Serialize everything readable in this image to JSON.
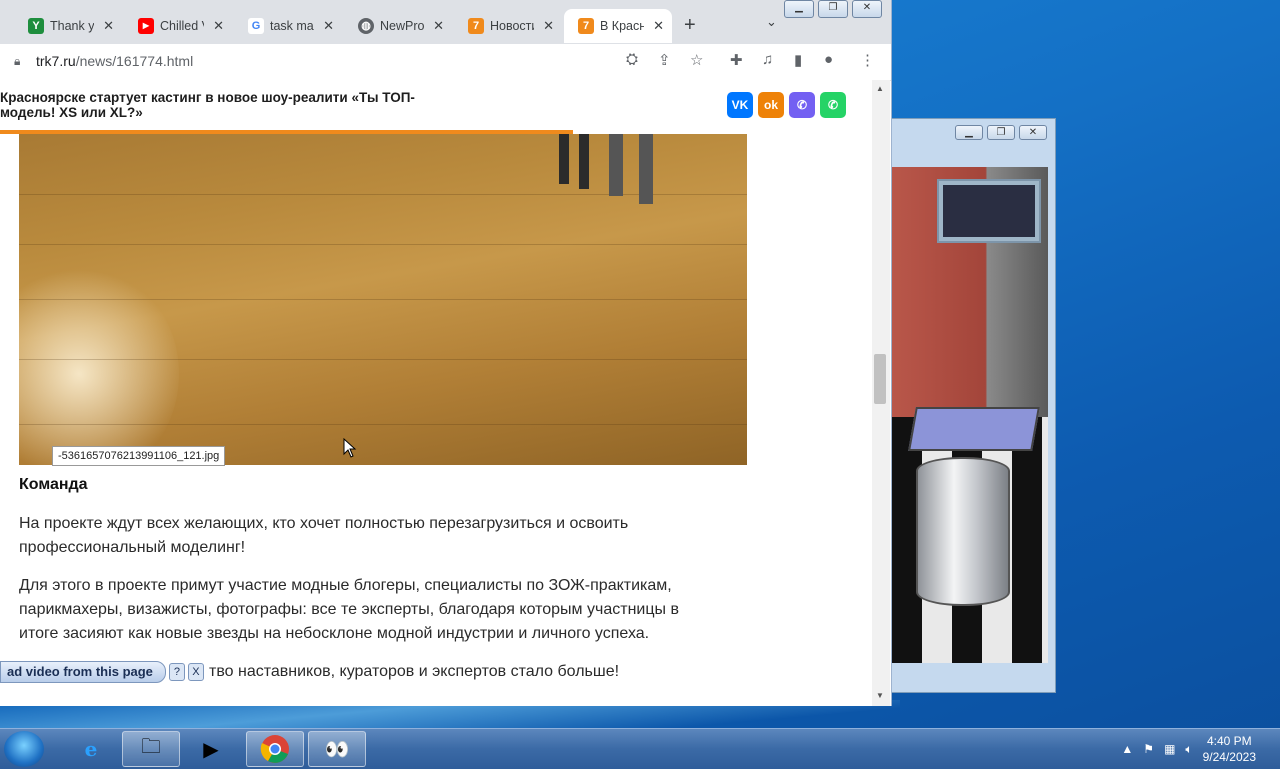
{
  "browser": {
    "tabs": [
      {
        "label": "Thank you",
        "icon": "tab-favicon-green",
        "color": "#1e8e3e",
        "glyph": "Y"
      },
      {
        "label": "Chilled V",
        "icon": "youtube-icon",
        "color": "#ff0000",
        "glyph": "▶"
      },
      {
        "label": "task man",
        "icon": "google-icon",
        "color": "#4285f4",
        "glyph": "G"
      },
      {
        "label": "NewProf",
        "icon": "globe-icon",
        "color": "#5f6368",
        "glyph": "◍"
      },
      {
        "label": "Новости",
        "icon": "trk7-icon",
        "color": "#f08a1c",
        "glyph": "7"
      },
      {
        "label": "В Красн",
        "icon": "trk7-icon",
        "color": "#f08a1c",
        "glyph": "7"
      }
    ],
    "url_domain": "trk7.ru",
    "url_path": "/news/161774.html"
  },
  "article": {
    "sticky_title": "Красноярске стартует кастинг в новое шоу-реалити «Ты ТОП-модель! XS или XL?»",
    "image_filename": "-5361657076213991106_121.jpg",
    "section_heading": "Команда",
    "paragraphs": [
      "На проекте ждут всех желающих, кто хочет полностью перезагрузиться и освоить профессиональный моделинг!",
      "Для этого в проекте примут участие модные блогеры, специалисты по ЗОЖ-практикам, парикмахеры, визажисты, фотографы: все те эксперты, благодаря которым участницы в итоге засияют как новые звезды на небосклоне модной индустрии и личного успеха."
    ],
    "partial_line": "тво наставников, кураторов и экспертов стало больше!"
  },
  "share": [
    {
      "name": "vk-share",
      "glyph": "VK",
      "color": "#0077ff"
    },
    {
      "name": "ok-share",
      "glyph": "ok",
      "color": "#ee8208"
    },
    {
      "name": "viber-share",
      "glyph": "✆",
      "color": "#7360f2"
    },
    {
      "name": "whatsapp-share",
      "glyph": "✆",
      "color": "#25d366"
    }
  ],
  "download_bar": {
    "label": "ad video from this page",
    "help": "?",
    "close": "X"
  },
  "taskbar": {
    "time": "4:40 PM",
    "date": "9/24/2023"
  }
}
